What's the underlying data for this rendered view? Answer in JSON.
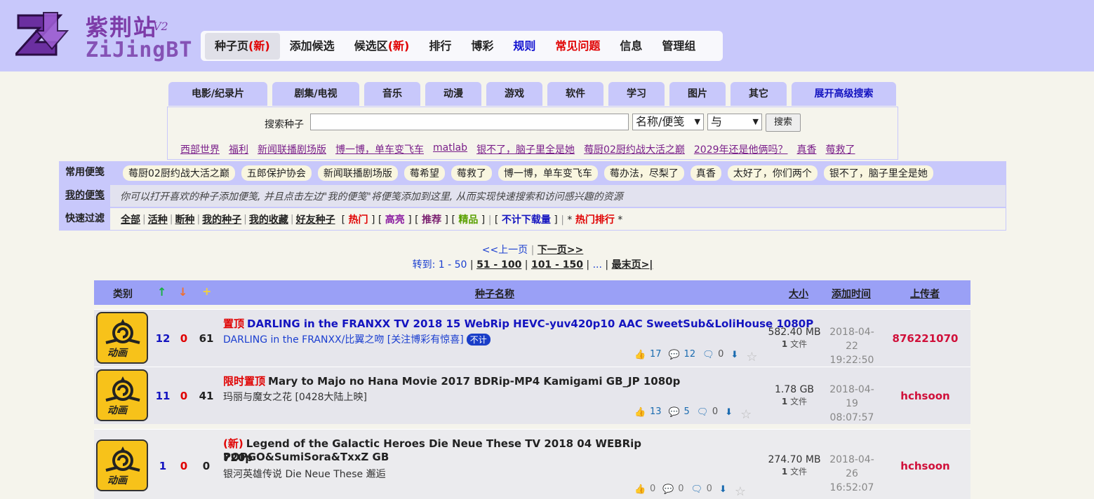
{
  "logo": {
    "cn": "紫荆站",
    "ver": "V2",
    "en": "ZiJingBT"
  },
  "mainnav": [
    {
      "label": "种子页",
      "extra": "(新)"
    },
    {
      "label": "添加候选",
      "extra": ""
    },
    {
      "label": "候选区",
      "extra": "(新)"
    },
    {
      "label": "排行",
      "extra": ""
    },
    {
      "label": "博彩",
      "extra": ""
    },
    {
      "label": "规则",
      "extra": ""
    },
    {
      "label": "常见问题",
      "extra": ""
    },
    {
      "label": "信息",
      "extra": ""
    },
    {
      "label": "管理组",
      "extra": ""
    }
  ],
  "categories": [
    "电影/纪录片",
    "剧集/电视",
    "音乐",
    "动漫",
    "游戏",
    "软件",
    "学习",
    "图片",
    "其它",
    "展开高级搜索"
  ],
  "search": {
    "label": "搜索种子",
    "value": "",
    "field_select": "名称/便笺",
    "logic_select": "与",
    "button": "搜索"
  },
  "hotwords": [
    "西部世界",
    "福利",
    "新闻联播剧场版",
    "博一博，单车变飞车",
    "matlab",
    "银不了，脑子里全是她",
    "莓厨02厨约战大活之巅",
    "2029年还是他俩吗？",
    "真香",
    "莓救了"
  ],
  "bookmarks": {
    "common_label": "常用便笺",
    "common": [
      "莓厨02厨约战大活之巅",
      "五郎保护协会",
      "新闻联播剧场版",
      "莓希望",
      "莓救了",
      "博一博，单车变飞车",
      "莓办法，尽梨了",
      "真香",
      "太好了，你们两个",
      "银不了，脑子里全是她"
    ],
    "mine_label": "我的便笺",
    "mine_hint": "你可以打开喜欢的种子添加便笺, 并且点击左边\"我的便笺\"将便笺添加到这里, 从而实现快速搜索和访问感兴趣的资源",
    "filter_label": "快速过滤",
    "filters": [
      "全部",
      "活种",
      "断种",
      "我的种子",
      "我的收藏",
      "好友种子"
    ],
    "flags": [
      "热门",
      "高亮",
      "推荐",
      "精品",
      "不计下载量",
      "热门排行"
    ]
  },
  "pager": {
    "prev": "<<上一页",
    "next": "下一页>>",
    "goto": "转到:",
    "p1": "1 - 50",
    "p2": "51 - 100",
    "p3": "101 - 150",
    "dots": "...",
    "last": "最末页>|"
  },
  "table": {
    "headers": {
      "category": "类别",
      "up": "↑",
      "down": "↓",
      "plus": "+",
      "name": "种子名称",
      "size": "大小",
      "added": "添加时间",
      "uploader": "上传者"
    },
    "rows": [
      {
        "cat": "动画",
        "seeders": "12",
        "leechers": "0",
        "completed": "61",
        "tag": "置顶",
        "title": "DARLING in the FRANXX TV 2018 15 WebRip HEVC-yuv420p10 AAC SweetSub&LoliHouse 1080P",
        "subtitle": "DARLING in the FRANXX/比翼之吻 [关注博彩有惊喜]",
        "badge": "不计",
        "likes": "17",
        "comments": "12",
        "chats": "0",
        "size": "582.40 MB",
        "files": "1",
        "files_label": "文件",
        "date": "2018-04-22",
        "time": "19:22:50",
        "uploader": "876221070"
      },
      {
        "cat": "动画",
        "seeders": "11",
        "leechers": "0",
        "completed": "41",
        "tag": "限时置顶",
        "title": "Mary to Majo no Hana Movie 2017 BDRip-MP4 Kamigami GB_JP 1080p",
        "subtitle": "玛丽与魔女之花 [0428大陆上映]",
        "badge": "",
        "likes": "13",
        "comments": "5",
        "chats": "0",
        "size": "1.78 GB",
        "files": "1",
        "files_label": "文件",
        "date": "2018-04-19",
        "time": "08:07:57",
        "uploader": "hchsoon"
      },
      {
        "cat": "动画",
        "seeders": "1",
        "leechers": "0",
        "completed": "0",
        "tag": "(新)",
        "title": "Legend of the Galactic Heroes Die Neue These TV 2018 04 WEBRip POPGO&SumiSora&TxxZ GB",
        "title2": "720p",
        "subtitle": "银河英雄传说 Die Neue These 邂逅",
        "badge": "",
        "likes": "0",
        "comments": "0",
        "chats": "0",
        "size": "274.70 MB",
        "files": "1",
        "files_label": "文件",
        "date": "2018-04-26",
        "time": "16:52:07",
        "uploader": "hchsoon"
      }
    ]
  }
}
